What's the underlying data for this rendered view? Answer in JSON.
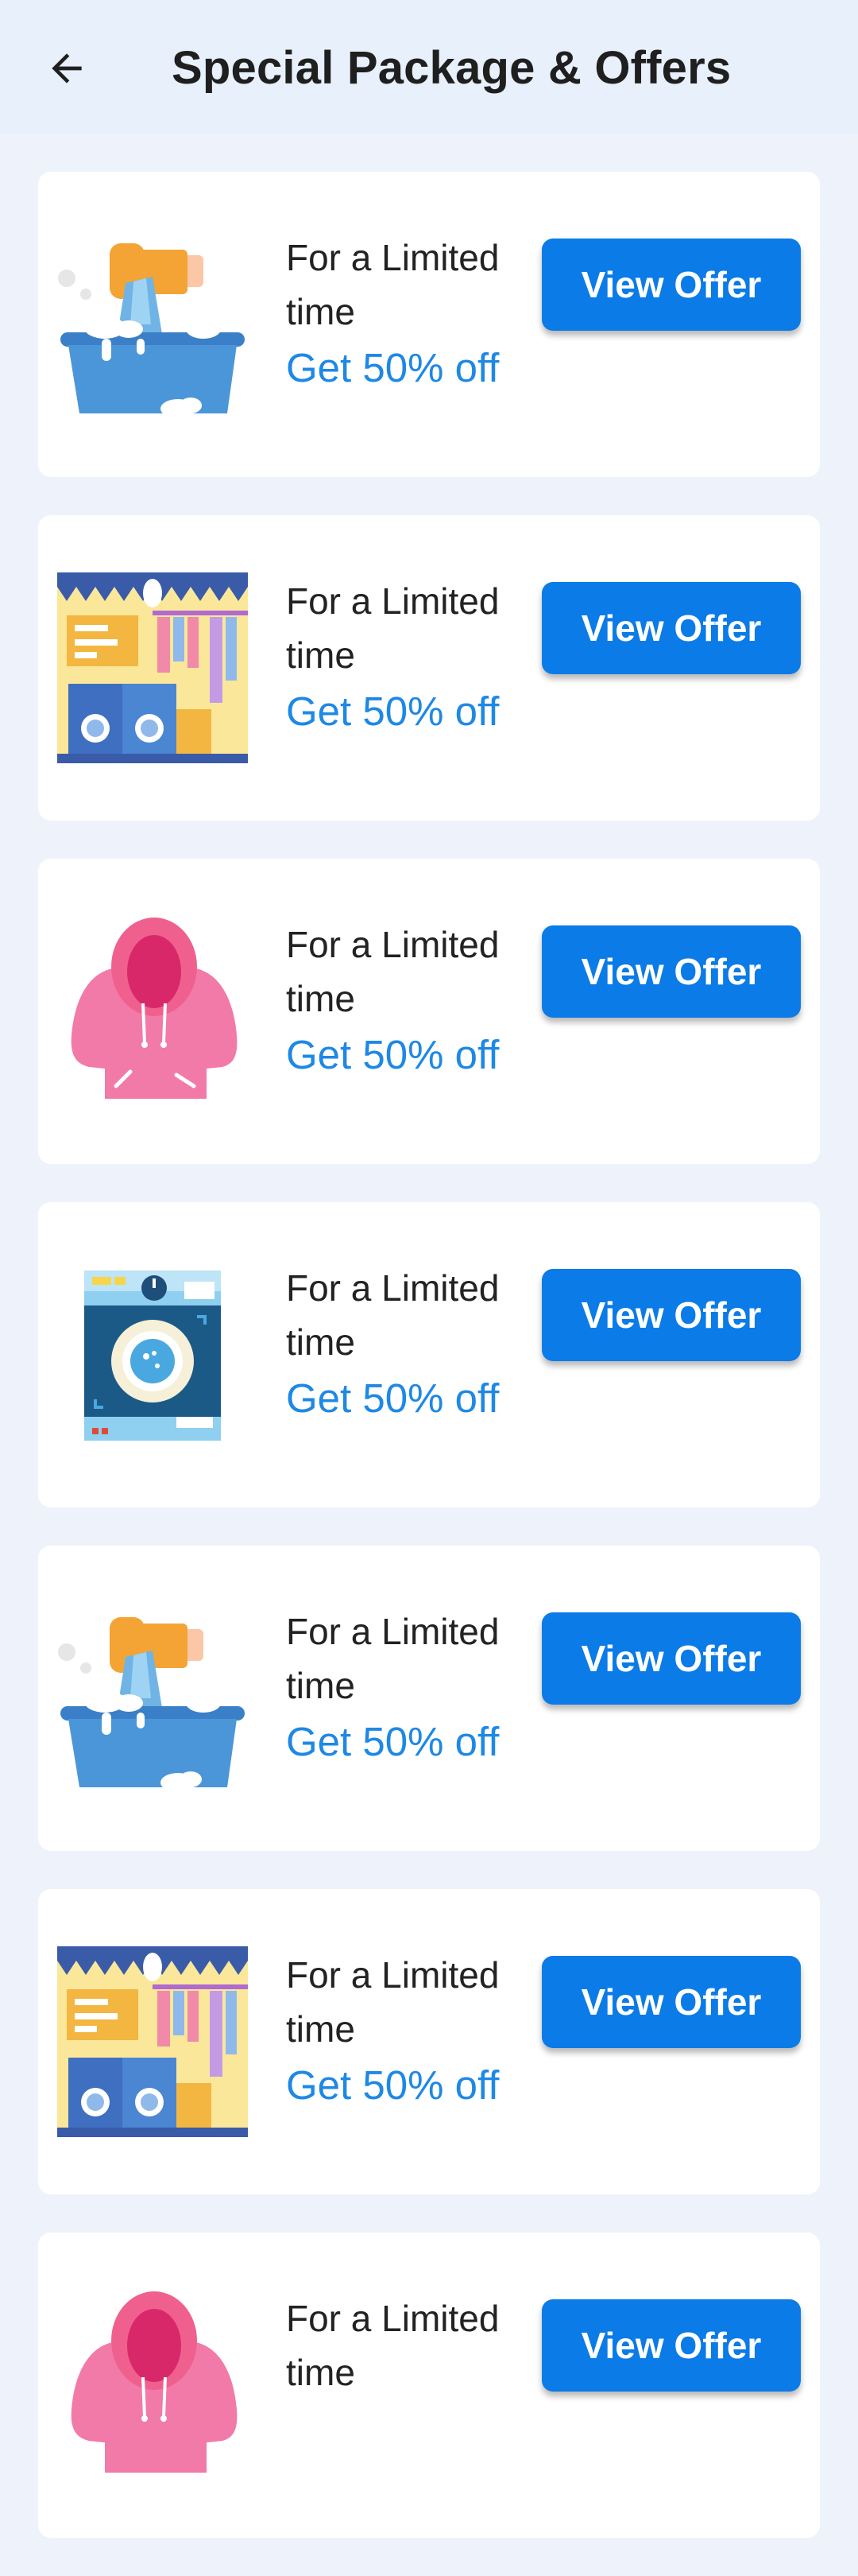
{
  "header": {
    "title": "Special Package & Offers",
    "back_icon": "arrow-back-icon"
  },
  "colors": {
    "background": "#eef3fb",
    "header_background": "#e7f0fb",
    "card": "#ffffff",
    "accent": "#0a7be7",
    "discount_text": "#1e88e5"
  },
  "offers": [
    {
      "image_icon": "washing-tub-icon",
      "heading": "For a Limited time",
      "discount": "Get 50% off",
      "button_label": "View Offer"
    },
    {
      "image_icon": "laundry-shop-icon",
      "heading": "For a Limited time",
      "discount": "Get 50% off",
      "button_label": "View Offer"
    },
    {
      "image_icon": "hoodie-icon",
      "heading": "For a Limited time",
      "discount": "Get 50% off",
      "button_label": "View Offer"
    },
    {
      "image_icon": "washing-machine-icon",
      "heading": "For a Limited time",
      "discount": "Get 50% off",
      "button_label": "View Offer"
    },
    {
      "image_icon": "washing-tub-icon",
      "heading": "For a Limited time",
      "discount": "Get 50% off",
      "button_label": "View Offer"
    },
    {
      "image_icon": "laundry-shop-icon",
      "heading": "For a Limited time",
      "discount": "Get 50% off",
      "button_label": "View Offer"
    },
    {
      "image_icon": "hoodie-icon",
      "heading": "For a Limited time",
      "discount": "",
      "button_label": "View Offer"
    }
  ]
}
